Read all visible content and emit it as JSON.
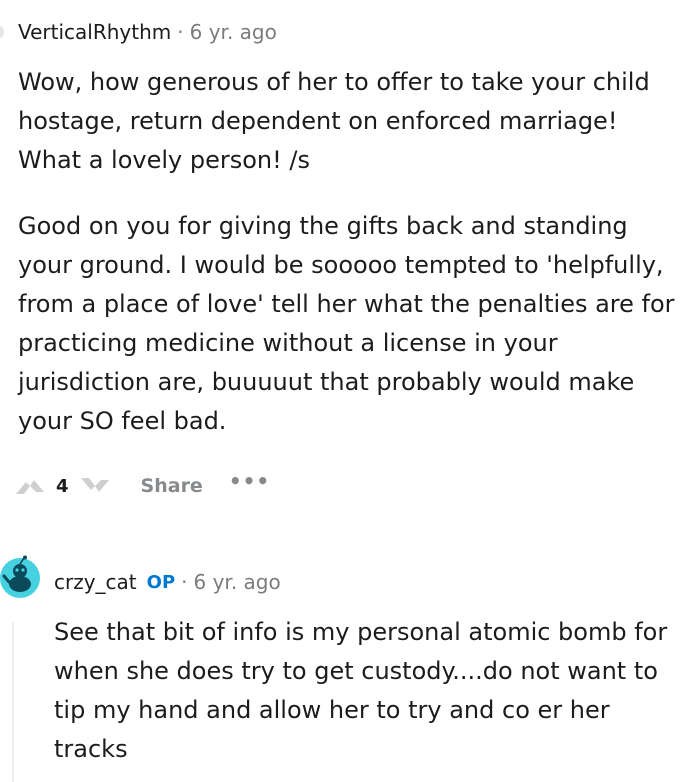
{
  "comment1": {
    "username": "VerticalRhythm",
    "separator": "·",
    "age": "6 yr. ago",
    "paragraphs": [
      "Wow, how generous of her to offer to take your child hostage, return dependent on enforced marriage! What a lovely person! /s",
      "Good on you for giving the gifts back and standing your ground. I would be sooooo tempted to 'helpfully, from a place of love' tell her what the penalties are for practicing medicine without a license in your jurisdiction are, buuuuut that probably would make your SO feel bad."
    ],
    "votes": "4",
    "share_label": "Share",
    "more_label": "•••"
  },
  "comment2": {
    "username": "crzy_cat",
    "op_badge": "OP",
    "separator": "·",
    "age": "6 yr. ago",
    "paragraphs": [
      "See that bit of info is my personal atomic bomb for when she does try to get custody....do not want to tip my hand and allow her to try and co er her tracks"
    ]
  },
  "icons": {
    "upvote": "upvote-icon",
    "downvote": "downvote-icon",
    "more": "more-options-icon",
    "avatar": "snoo-avatar-icon"
  },
  "colors": {
    "text": "#1c1c1c",
    "meta": "#7c7c7c",
    "op": "#0079d3",
    "avatar_bg": "#46d1e0",
    "vote_icon": "#cfcfcf"
  }
}
